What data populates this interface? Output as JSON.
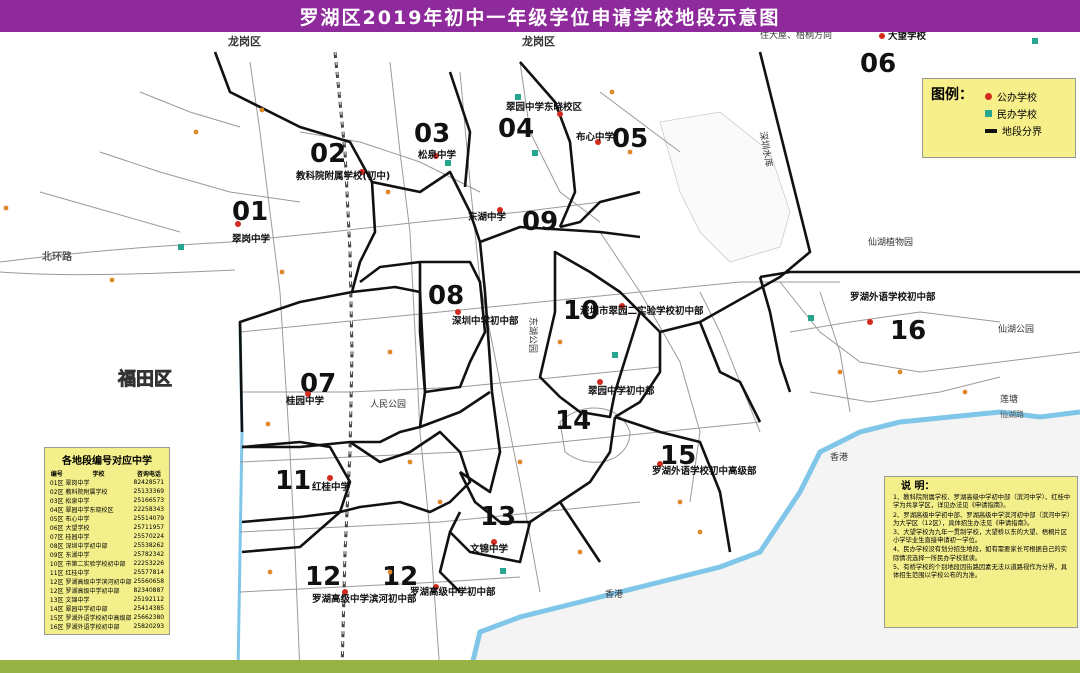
{
  "title": "罗湖区2019年初中一年级学位申请学校地段示意图",
  "colors": {
    "title_bg": "#8e2a9c",
    "public_school": "#d42a1e",
    "private_school": "#27a58f",
    "boundary": "#111111",
    "water": "#7fc6e8",
    "legend_bg": "#f6ef8a"
  },
  "districts": {
    "longgang_left": "龙岗区",
    "longgang_right": "龙岗区",
    "futian": "福田区",
    "top_direction": "住大屋、梧桐方向"
  },
  "zones": [
    {
      "num": "01",
      "school": "翠岗中学"
    },
    {
      "num": "02",
      "school": "教科院附属学校(初中)"
    },
    {
      "num": "03",
      "school": "松泉中学"
    },
    {
      "num": "04",
      "school": "翠园中学东晓校区"
    },
    {
      "num": "05",
      "school": "布心中学"
    },
    {
      "num": "06",
      "school": "大望学校"
    },
    {
      "num": "07",
      "school": "桂园中学"
    },
    {
      "num": "08",
      "school": "深圳中学初中部"
    },
    {
      "num": "09",
      "school": "东湖中学"
    },
    {
      "num": "10",
      "school": "深圳市翠园二实验学校初中部"
    },
    {
      "num": "11",
      "school": "红桂中学"
    },
    {
      "num": "12",
      "school": "罗湖高级中学滨河初中部"
    },
    {
      "num": "12b",
      "school": "罗湖高级中学初中部"
    },
    {
      "num": "13",
      "school": "文锦中学"
    },
    {
      "num": "14",
      "school": "翠园中学初中部"
    },
    {
      "num": "15",
      "school": "罗湖外语学校初中高级部"
    },
    {
      "num": "16",
      "school": "罗湖外语学校初中部"
    }
  ],
  "legend": {
    "title": "图例：",
    "public": "公办学校",
    "private": "民办学校",
    "boundary": "地段分界"
  },
  "table": {
    "title": "各地段编号对应中学",
    "headers": [
      "编号",
      "学校",
      "咨询电话"
    ],
    "rows": [
      [
        "01区",
        "翠岗中学",
        "82428571"
      ],
      [
        "02区",
        "教科院附属学校",
        "25133369"
      ],
      [
        "03区",
        "松泉中学",
        "25166573"
      ],
      [
        "04区",
        "翠园中学东晓校区",
        "22258343"
      ],
      [
        "05区",
        "布心中学",
        "25514079"
      ],
      [
        "06区",
        "大望学校",
        "25711957"
      ],
      [
        "07区",
        "桂园中学",
        "25570224"
      ],
      [
        "08区",
        "深圳中学初中部",
        "25538262"
      ],
      [
        "09区",
        "东湖中学",
        "25782342"
      ],
      [
        "10区",
        "市第二实验学校初中部",
        "22253226"
      ],
      [
        "11区",
        "红桂中学",
        "25577814"
      ],
      [
        "12区",
        "罗湖高级中学滨河初中部",
        "25560658"
      ],
      [
        "12区",
        "罗湖高级中学初中部",
        "82340887"
      ],
      [
        "13区",
        "文锦中学",
        "25192112"
      ],
      [
        "14区",
        "翠园中学初中部",
        "25414385"
      ],
      [
        "15区",
        "罗湖外语学校初中高级部",
        "25662380"
      ],
      [
        "16区",
        "罗湖外语学校初中部",
        "25820293"
      ]
    ]
  },
  "notes": {
    "title": "说 明：",
    "items": [
      "1、教科院附属学校、罗湖高级中学初中部（滨河中学）、红桂中学为共享学区，详见办法见《申请指南》。",
      "2、罗湖高级中学初中部、罗湖高级中学滨河初中部（滨河中学）为大学区（12区），具体招生办法见《申请指南》。",
      "3、大望学校为九年一贯制学校，大望桥以东的大望、梧桐片区小学毕业生直接申请初一学位。",
      "4、民办学校没有划分招生地段，如有需要家长可根据自己的实际情况选择一所民办学校就读。",
      "5、有桥学校的个别地段因街路因素无法以道路视作为分界，具体招生范围以学校公布的为准。"
    ]
  },
  "map_labels": {
    "north_ring": "北环路",
    "shenzhen_reservoir": "深圳水库",
    "xianhu": "仙湖植物园",
    "xianhu_park": "仙湖公园",
    "donghu_park": "东湖公园",
    "renmin_park": "人民公园",
    "hk": "香港",
    "liantang": "莲塘",
    "xianhu_rd": "仙湖路"
  }
}
